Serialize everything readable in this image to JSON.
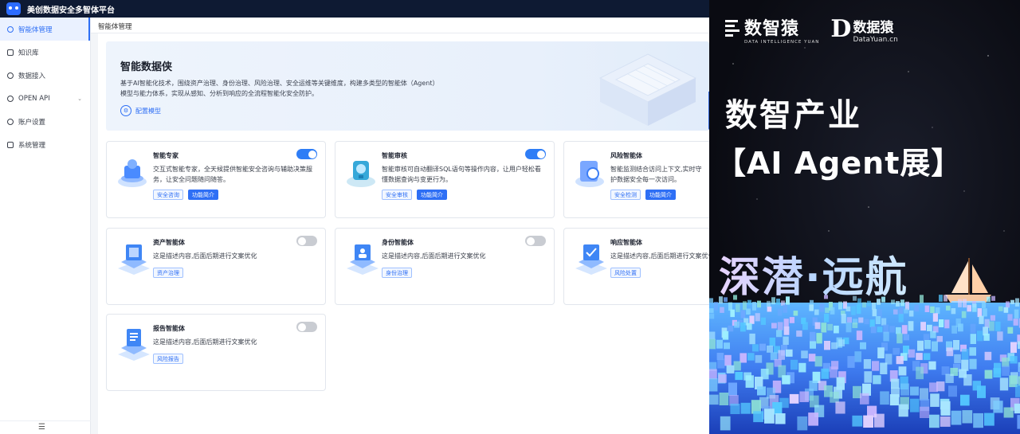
{
  "app": {
    "title": "美创数据安全多智体平台",
    "breadcrumb": "智能体管理"
  },
  "sidebar": {
    "items": [
      {
        "label": "智能体管理",
        "active": true
      },
      {
        "label": "知识库"
      },
      {
        "label": "数据接入"
      },
      {
        "label": "OPEN API",
        "has_chevron": true
      },
      {
        "label": "账户设置"
      },
      {
        "label": "系统管理"
      }
    ]
  },
  "hero": {
    "title": "智能数据侠",
    "desc_line1": "基于AI智能化技术，围绕资产治理、身份治理、风险治理、安全运维等关键维度，构建多类型的智能体（Agent）",
    "desc_line2": "模型与能力体系，实现从感知、分析到响应的全流程智能化安全防护。",
    "config_label": "配置模型"
  },
  "cards": [
    {
      "name": "智能专家",
      "desc": "交互式智能专家，全天候提供智能安全咨询与辅助决策服务，让安全问题随问随答。",
      "tags": [
        "安全咨询",
        "功能简介"
      ],
      "enabled": true
    },
    {
      "name": "智能审核",
      "desc": "智能审核可自动翻译SQL语句等操作内容，让用户轻松看懂数据查询与变更行为。",
      "tags": [
        "安全审核",
        "功能简介"
      ],
      "enabled": true
    },
    {
      "name": "风险智能体",
      "desc": "智能监测结合访问上下文,实时守护数据安全每一次访问。",
      "tags": [
        "安全检测",
        "功能简介"
      ],
      "enabled": true
    },
    {
      "name": "资产智能体",
      "desc": "这是描述内容,后面后期进行文案优化",
      "tags": [
        "资产治理"
      ],
      "enabled": false
    },
    {
      "name": "身份智能体",
      "desc": "这是描述内容,后面后期进行文案优化",
      "tags": [
        "身份治理"
      ],
      "enabled": false
    },
    {
      "name": "响应智能体",
      "desc": "这是描述内容,后面后期进行文案优化",
      "tags": [
        "风险处置"
      ],
      "enabled": false
    },
    {
      "name": "报告智能体",
      "desc": "这是描述内容,后面后期进行文案优化",
      "tags": [
        "风险报告"
      ],
      "enabled": false
    }
  ],
  "banner": {
    "brand1_name": "数智猿",
    "brand1_sub": "DATA INTELLIGENCE YUAN",
    "brand2_mark": "D",
    "brand2_name": "数据猿",
    "brand2_sub": "DataYuan.cn",
    "headline1": "数智产业",
    "headline2": "【AI Agent展】",
    "slogan": "深潜·远航"
  },
  "colors": {
    "accent": "#2e6ff5",
    "topbar": "#0e1a33",
    "toggle_on": "#2e7df6",
    "toggle_off": "#c9ccd2"
  }
}
